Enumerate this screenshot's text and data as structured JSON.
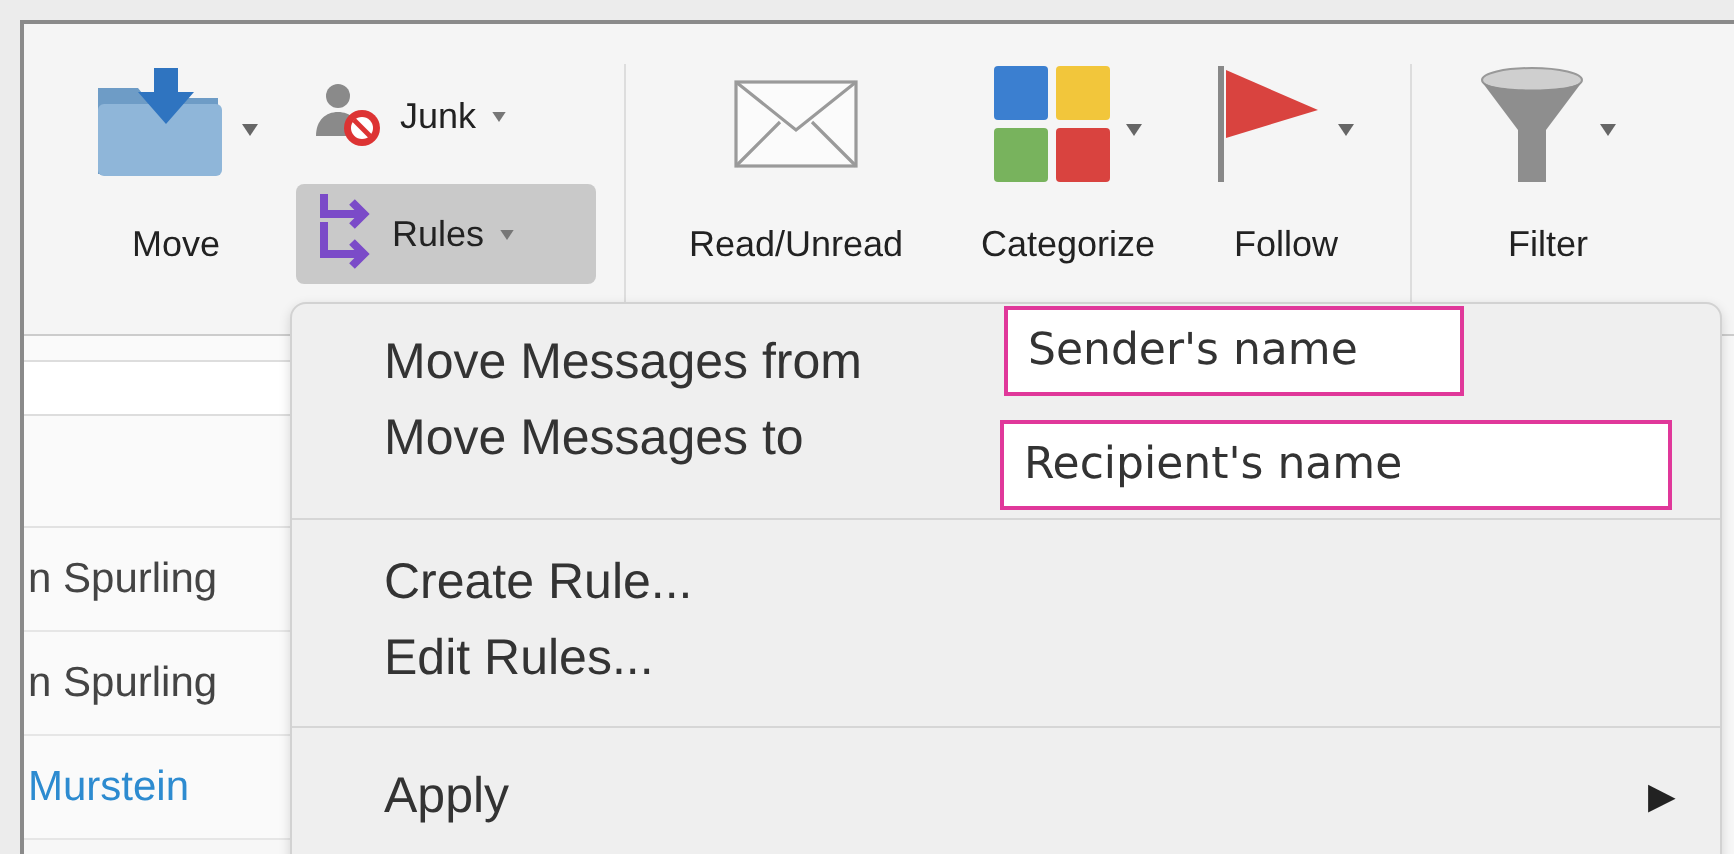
{
  "ribbon": {
    "groups": [
      {
        "items": [
          {
            "kind": "large",
            "label": "Move",
            "dropdown": true
          },
          {
            "kind": "stack",
            "items": [
              {
                "label": "Junk",
                "dropdown": true,
                "selected": false
              },
              {
                "label": "Rules",
                "dropdown": true,
                "selected": true
              }
            ]
          }
        ]
      },
      {
        "items": [
          {
            "kind": "large",
            "label": "Read/Unread",
            "dropdown": false
          },
          {
            "kind": "large",
            "label": "Categorize",
            "dropdown": true
          },
          {
            "kind": "large",
            "label": "Follow",
            "dropdown": true
          }
        ]
      },
      {
        "items": [
          {
            "kind": "large",
            "label": "Filter",
            "dropdown": true
          }
        ]
      }
    ]
  },
  "message_list": {
    "rows": [
      {
        "sender": "n Spurling",
        "unread": false
      },
      {
        "sender": "n Spurling",
        "unread": false
      },
      {
        "sender": "Murstein",
        "unread": true
      }
    ]
  },
  "rules_menu": {
    "sections": [
      {
        "items": [
          {
            "label": "Move Messages from",
            "callout": "Sender's name"
          },
          {
            "label": "Move Messages to",
            "callout": "Recipient's name"
          }
        ]
      },
      {
        "items": [
          {
            "label": "Create Rule..."
          },
          {
            "label": "Edit Rules..."
          }
        ]
      },
      {
        "items": [
          {
            "label": "Apply",
            "submenu": "▶"
          }
        ]
      }
    ]
  }
}
